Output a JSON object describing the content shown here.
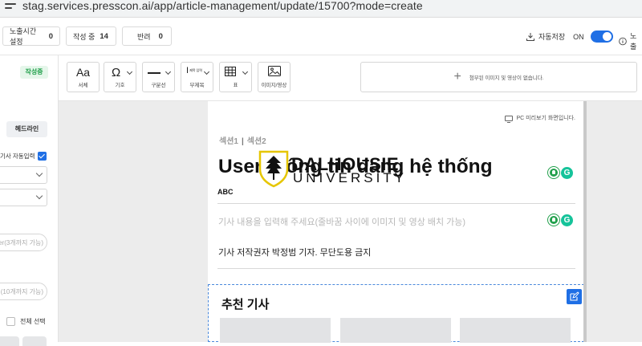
{
  "browser": {
    "url": "stag.services.presscon.ai/app/article-management/update/15700?mode=create"
  },
  "status": {
    "expose_time_label": "노출시간 설정",
    "expose_time_count": "0",
    "writing_label": "작성 중",
    "writing_count": "14",
    "rejected_label": "반려",
    "rejected_count": "0",
    "autosave_label": "자동저장",
    "autosave_state": "ON",
    "expose_cut": "노출"
  },
  "sidebar": {
    "status_badge": "작성중",
    "headline_button": "헤드라인",
    "auto_input_label": "기사 자동입력",
    "keyword_placeholder": "er(3개까지 가능)",
    "tag_placeholder": "(10개까지 가능)",
    "select_all_label": "전체 선택"
  },
  "toolbar": {
    "tools": [
      {
        "icon": "Aa",
        "label": "서체"
      },
      {
        "icon": "Ω",
        "label": "기호"
      },
      {
        "icon": "—",
        "label": "구분선"
      },
      {
        "icon": "I",
        "label": "부제목",
        "icon_small": "제목 입력"
      },
      {
        "icon": "▦",
        "label": "표"
      },
      {
        "icon": "🖼",
        "label": "이미지/영상"
      }
    ],
    "attach_hint": "첨부된 이미지 및 영상이 없습니다."
  },
  "editor": {
    "pc_preview": "PC 미리보기 화면입니다.",
    "section1": "섹션1",
    "section2": "섹션2",
    "title": "User thông tin đang hệ thống",
    "subtitle": "ABC",
    "body_placeholder": "기사 내용을 입력해 주세요(줄바꿈 사이에 이미지 및 영상 배치 가능)",
    "copyright": "기사 저작권자 박정범 기자. 무단도용 금지",
    "recommend_title": "추천 기사"
  },
  "watermark": {
    "line1": "DALHOUSIE",
    "line2": "UNIVERSITY"
  },
  "colors": {
    "accent": "#1f6fe5",
    "badge_green": "#21a04b",
    "grammarly": "#15c39a"
  }
}
